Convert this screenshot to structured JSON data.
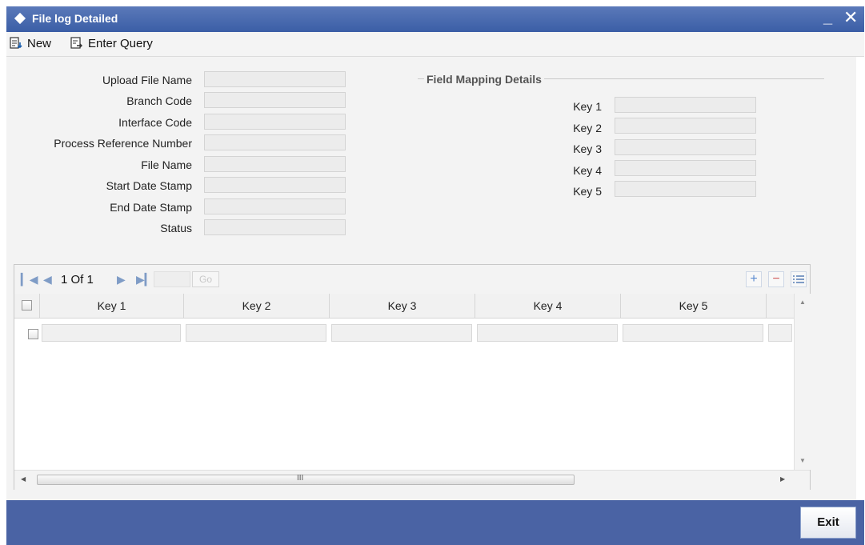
{
  "window": {
    "title": "File log Detailed",
    "minimize_label": "_",
    "close_label": "✕"
  },
  "toolbar": {
    "new_label": "New",
    "enter_query_label": "Enter Query"
  },
  "form": {
    "upload_file_name": {
      "label": "Upload File Name",
      "value": ""
    },
    "branch_code": {
      "label": "Branch Code",
      "value": ""
    },
    "interface_code": {
      "label": "Interface Code",
      "value": ""
    },
    "process_reference_number": {
      "label": "Process Reference Number",
      "value": ""
    },
    "file_name": {
      "label": "File Name",
      "value": ""
    },
    "start_date_stamp": {
      "label": "Start Date Stamp",
      "value": ""
    },
    "end_date_stamp": {
      "label": "End Date Stamp",
      "value": ""
    },
    "status": {
      "label": "Status",
      "value": ""
    }
  },
  "field_mapping": {
    "title": "Field Mapping Details",
    "keys": [
      {
        "label": "Key 1",
        "value": ""
      },
      {
        "label": "Key 2",
        "value": ""
      },
      {
        "label": "Key 3",
        "value": ""
      },
      {
        "label": "Key 4",
        "value": ""
      },
      {
        "label": "Key 5",
        "value": ""
      }
    ]
  },
  "grid": {
    "pagination": {
      "current": "1",
      "of_label": "Of",
      "total": "1",
      "go_label": "Go",
      "page_value": ""
    },
    "columns": [
      "Key 1",
      "Key 2",
      "Key 3",
      "Key 4",
      "Key 5"
    ],
    "rows": [
      [
        "",
        "",
        "",
        "",
        ""
      ]
    ],
    "scroll_grip": "III"
  },
  "footer": {
    "exit_label": "Exit"
  },
  "colors": {
    "title_bar": "#3b5ea6",
    "footer_bar": "#4a63a4",
    "content_bg": "#f3f3f3"
  }
}
